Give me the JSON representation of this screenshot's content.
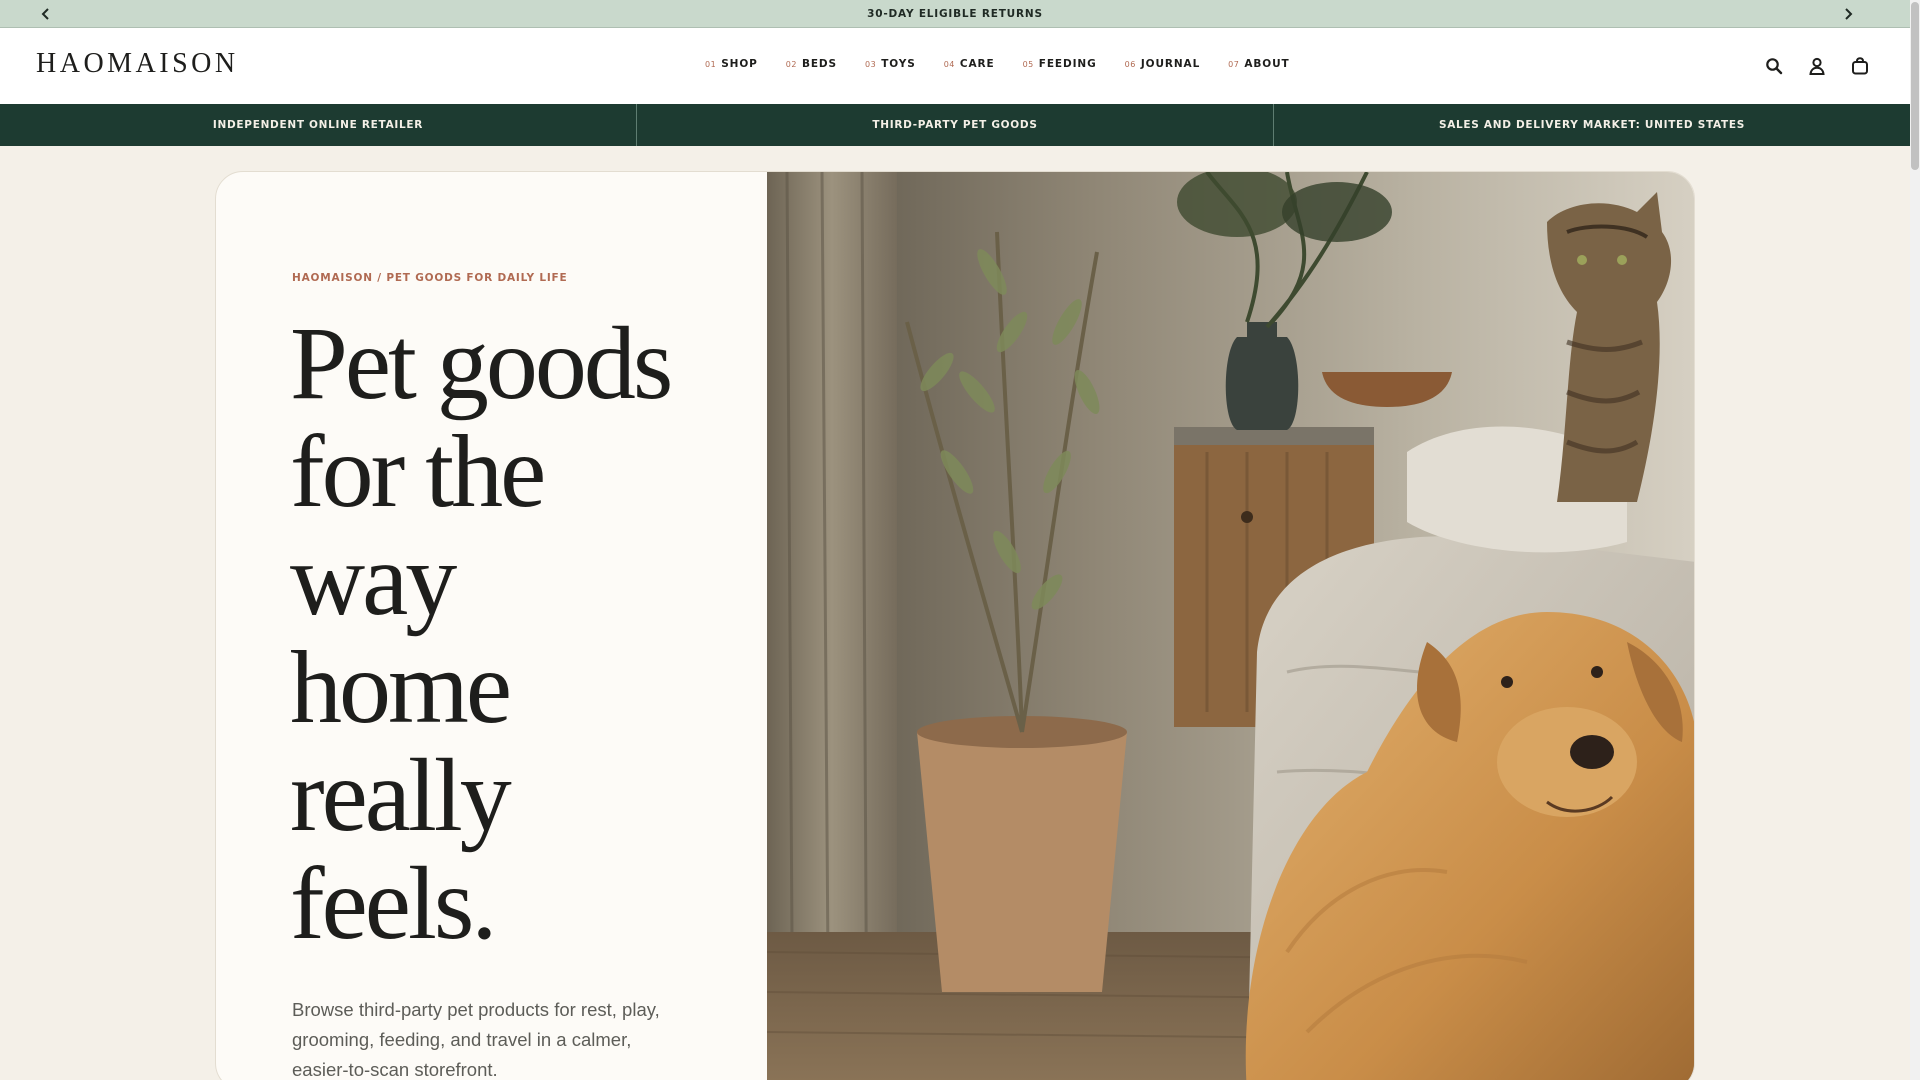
{
  "announcement": {
    "text": "30-DAY ELIGIBLE RETURNS",
    "prev_icon": "chevron-left-icon",
    "next_icon": "chevron-right-icon"
  },
  "header": {
    "logo": "HAOMAISON",
    "nav": [
      {
        "num": "01",
        "label": "SHOP"
      },
      {
        "num": "02",
        "label": "BEDS"
      },
      {
        "num": "03",
        "label": "TOYS"
      },
      {
        "num": "04",
        "label": "CARE"
      },
      {
        "num": "05",
        "label": "FEEDING"
      },
      {
        "num": "06",
        "label": "JOURNAL"
      },
      {
        "num": "07",
        "label": "ABOUT"
      }
    ],
    "icons": [
      "search-icon",
      "account-icon",
      "bag-icon"
    ]
  },
  "info_strip": [
    "INDEPENDENT ONLINE RETAILER",
    "THIRD-PARTY PET GOODS",
    "SALES AND DELIVERY MARKET: UNITED STATES"
  ],
  "hero": {
    "eyebrow": "HAOMAISON / PET GOODS FOR DAILY LIFE",
    "headline_lines": [
      "Pet goods",
      "for the",
      "way",
      "home",
      "really",
      "feels."
    ],
    "subtext": "Browse third-party pet products for rest, play, grooming, feeding, and travel in a calmer, easier-to-scan storefront."
  },
  "colors": {
    "announcement_bg": "#c9d9cc",
    "strip_bg": "#1d3b31",
    "accent": "#b06a52",
    "page_bg": "#f4f0e8"
  }
}
